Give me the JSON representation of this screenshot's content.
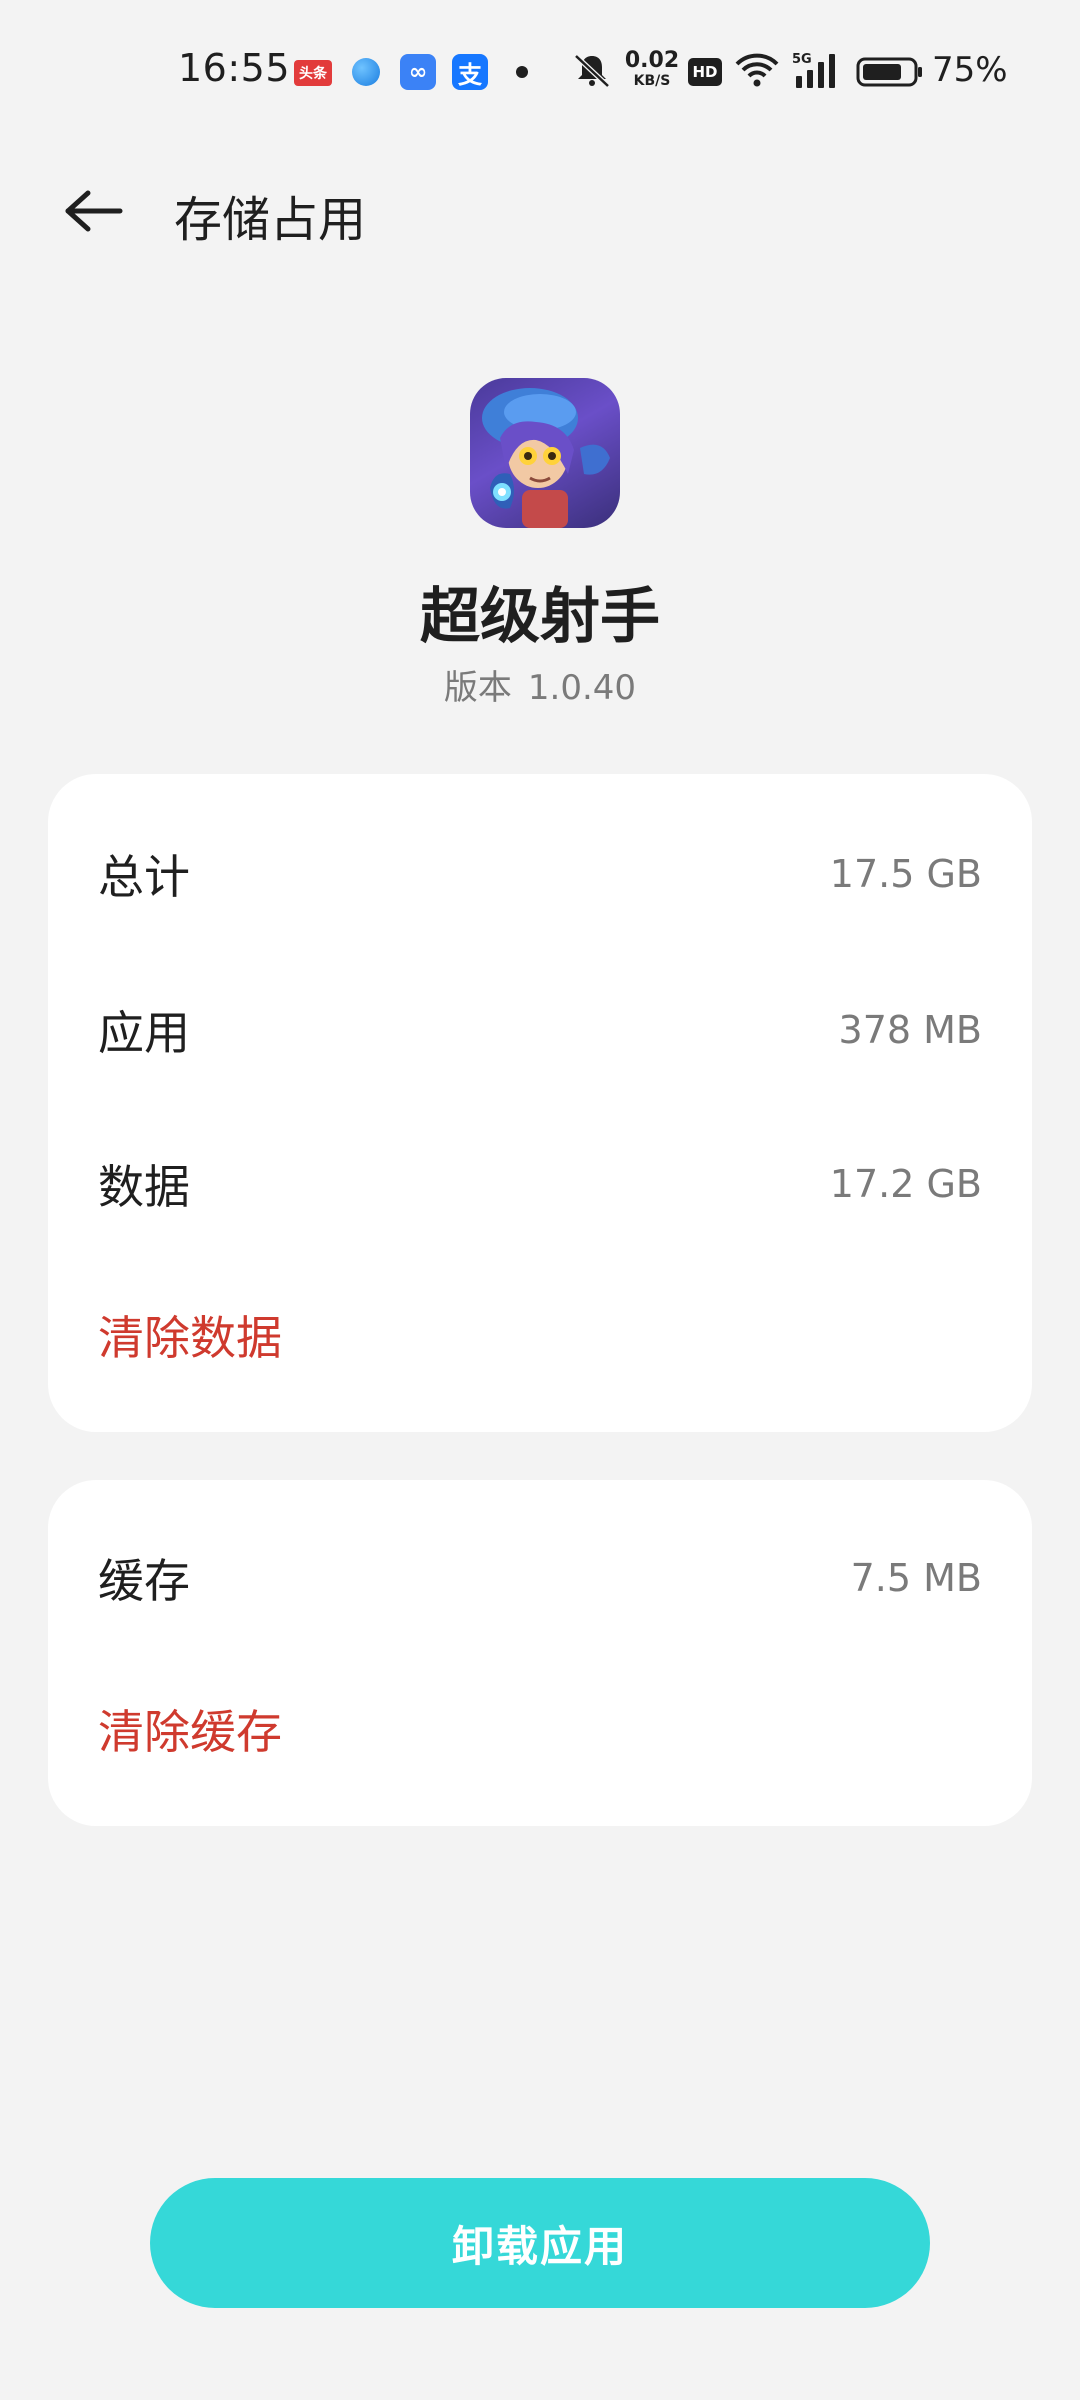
{
  "status_bar": {
    "time": "16:55",
    "toutiao_label": "头条",
    "baidu_glyph": "∞",
    "alipay_glyph": "支",
    "net_speed_value": "0.02",
    "net_speed_unit": "KB/S",
    "hd_label": "HD",
    "signal_label": "5G",
    "battery_percent": "75%"
  },
  "header": {
    "title": "存储占用"
  },
  "app": {
    "name": "超级射手",
    "version_label": "版本",
    "version_number": "1.0.40"
  },
  "storage": {
    "rows": [
      {
        "label": "总计",
        "value": "17.5 GB"
      },
      {
        "label": "应用",
        "value": "378 MB"
      },
      {
        "label": "数据",
        "value": "17.2 GB"
      }
    ],
    "clear_data_label": "清除数据"
  },
  "cache": {
    "label": "缓存",
    "value": "7.5 MB",
    "clear_cache_label": "清除缓存"
  },
  "uninstall_label": "卸载应用",
  "colors": {
    "background": "#f3f3f3",
    "card": "#ffffff",
    "danger_text": "#cf3a2e",
    "accent_button": "#35d8d8",
    "secondary_text": "#7a7a7a"
  }
}
